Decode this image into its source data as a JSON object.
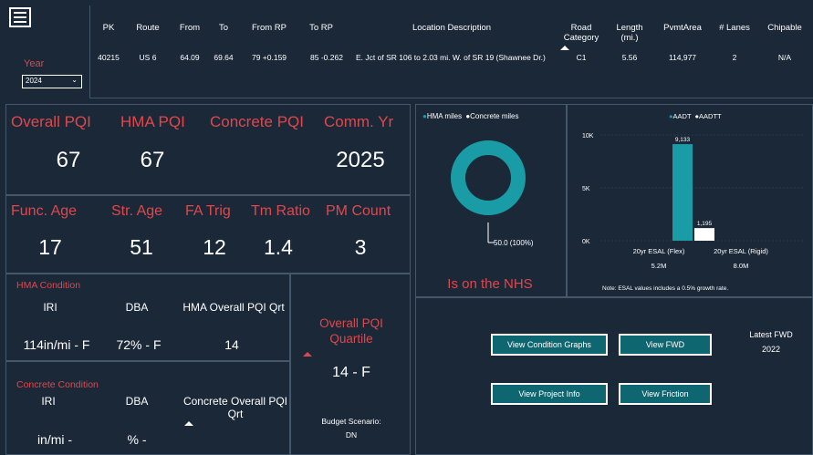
{
  "header": {
    "year_label": "Year",
    "year_value": "2024",
    "columns": [
      "PK",
      "Route",
      "From",
      "To",
      "From RP",
      "To RP",
      "Location Description",
      "Road Category",
      "Length (mi.)",
      "PvmtArea",
      "# Lanes",
      "Chipable"
    ],
    "row": {
      "pk": "40215",
      "route": "US 6",
      "from": "64.09",
      "to": "69.64",
      "from_rp": "79 +0.159",
      "to_rp": "85 -0.262",
      "location": "E. Jct of SR 106 to 2.03 mi. W. of SR 19 (Shawnee Dr.)",
      "road_category": "C1",
      "length": "5.56",
      "pvmt_area": "114,977",
      "lanes": "2",
      "chipable": "N/A"
    }
  },
  "pqi": {
    "overall_label": "Overall PQI",
    "overall_value": "67",
    "hma_label": "HMA PQI",
    "hma_value": "67",
    "concrete_label": "Concrete PQI",
    "concrete_value": "",
    "comm_yr_label": "Comm. Yr",
    "comm_yr_value": "2025"
  },
  "ages": {
    "func_age_label": "Func. Age",
    "func_age_value": "17",
    "str_age_label": "Str. Age",
    "str_age_value": "51",
    "fa_trig_label": "FA Trig",
    "fa_trig_value": "12",
    "tm_ratio_label": "Tm Ratio",
    "tm_ratio_value": "1.4",
    "pm_count_label": "PM Count",
    "pm_count_value": "3"
  },
  "hma_condition": {
    "title": "HMA Condition",
    "iri_label": "IRI",
    "iri_value": "114in/mi - F",
    "dba_label": "DBA",
    "dba_value": "72% - F",
    "qrt_label": "HMA Overall PQI Qrt",
    "qrt_value": "14"
  },
  "concrete_condition": {
    "title": "Concrete Condition",
    "iri_label": "IRI",
    "iri_value": "in/mi -",
    "dba_label": "DBA",
    "dba_value": "% -",
    "qrt_label": "Concrete Overall PQI Qrt",
    "qrt_value": ""
  },
  "quartile": {
    "label": "Overall PQI Quartile",
    "value": "14 - F",
    "budget_label": "Budget Scenario:",
    "budget_value": "DN"
  },
  "donut": {
    "legend_hma": "HMA miles",
    "legend_concrete": "Concrete miles",
    "data_label": "50.0 (100%)",
    "nhs_text": "Is on the NHS",
    "hma_color": "#1a9ca6",
    "concrete_color": "#ffffff"
  },
  "chart_data": {
    "type": "bar",
    "categories": [
      "20yr ESAL (Flex)",
      "20yr ESAL (Rigid)"
    ],
    "series": [
      {
        "name": "AADT",
        "values": [
          9133,
          null
        ],
        "color": "#1a9ca6"
      },
      {
        "name": "AADTT",
        "values": [
          null,
          1195
        ],
        "color": "#ffffff"
      }
    ],
    "data_labels": [
      "9,133",
      "1,195"
    ],
    "y_ticks": [
      "10K",
      "5K",
      "0K"
    ],
    "ylim": [
      0,
      10000
    ],
    "sub_values": [
      "5.2M",
      "8.0M"
    ],
    "note": "Note:  ESAL values includes a 0.5% growth rate.",
    "legend_placement": "top"
  },
  "actions": {
    "condition_graphs": "View Condition Graphs",
    "fwd": "View FWD",
    "project_info": "View Project Info",
    "friction": "View Friction",
    "latest_fwd_label": "Latest FWD",
    "latest_fwd_value": "2022"
  },
  "colors": {
    "background": "#1b2838",
    "accent_red": "#e0474c",
    "teal": "#1a9ca6",
    "button": "#0e6670",
    "border": "#44576b"
  }
}
